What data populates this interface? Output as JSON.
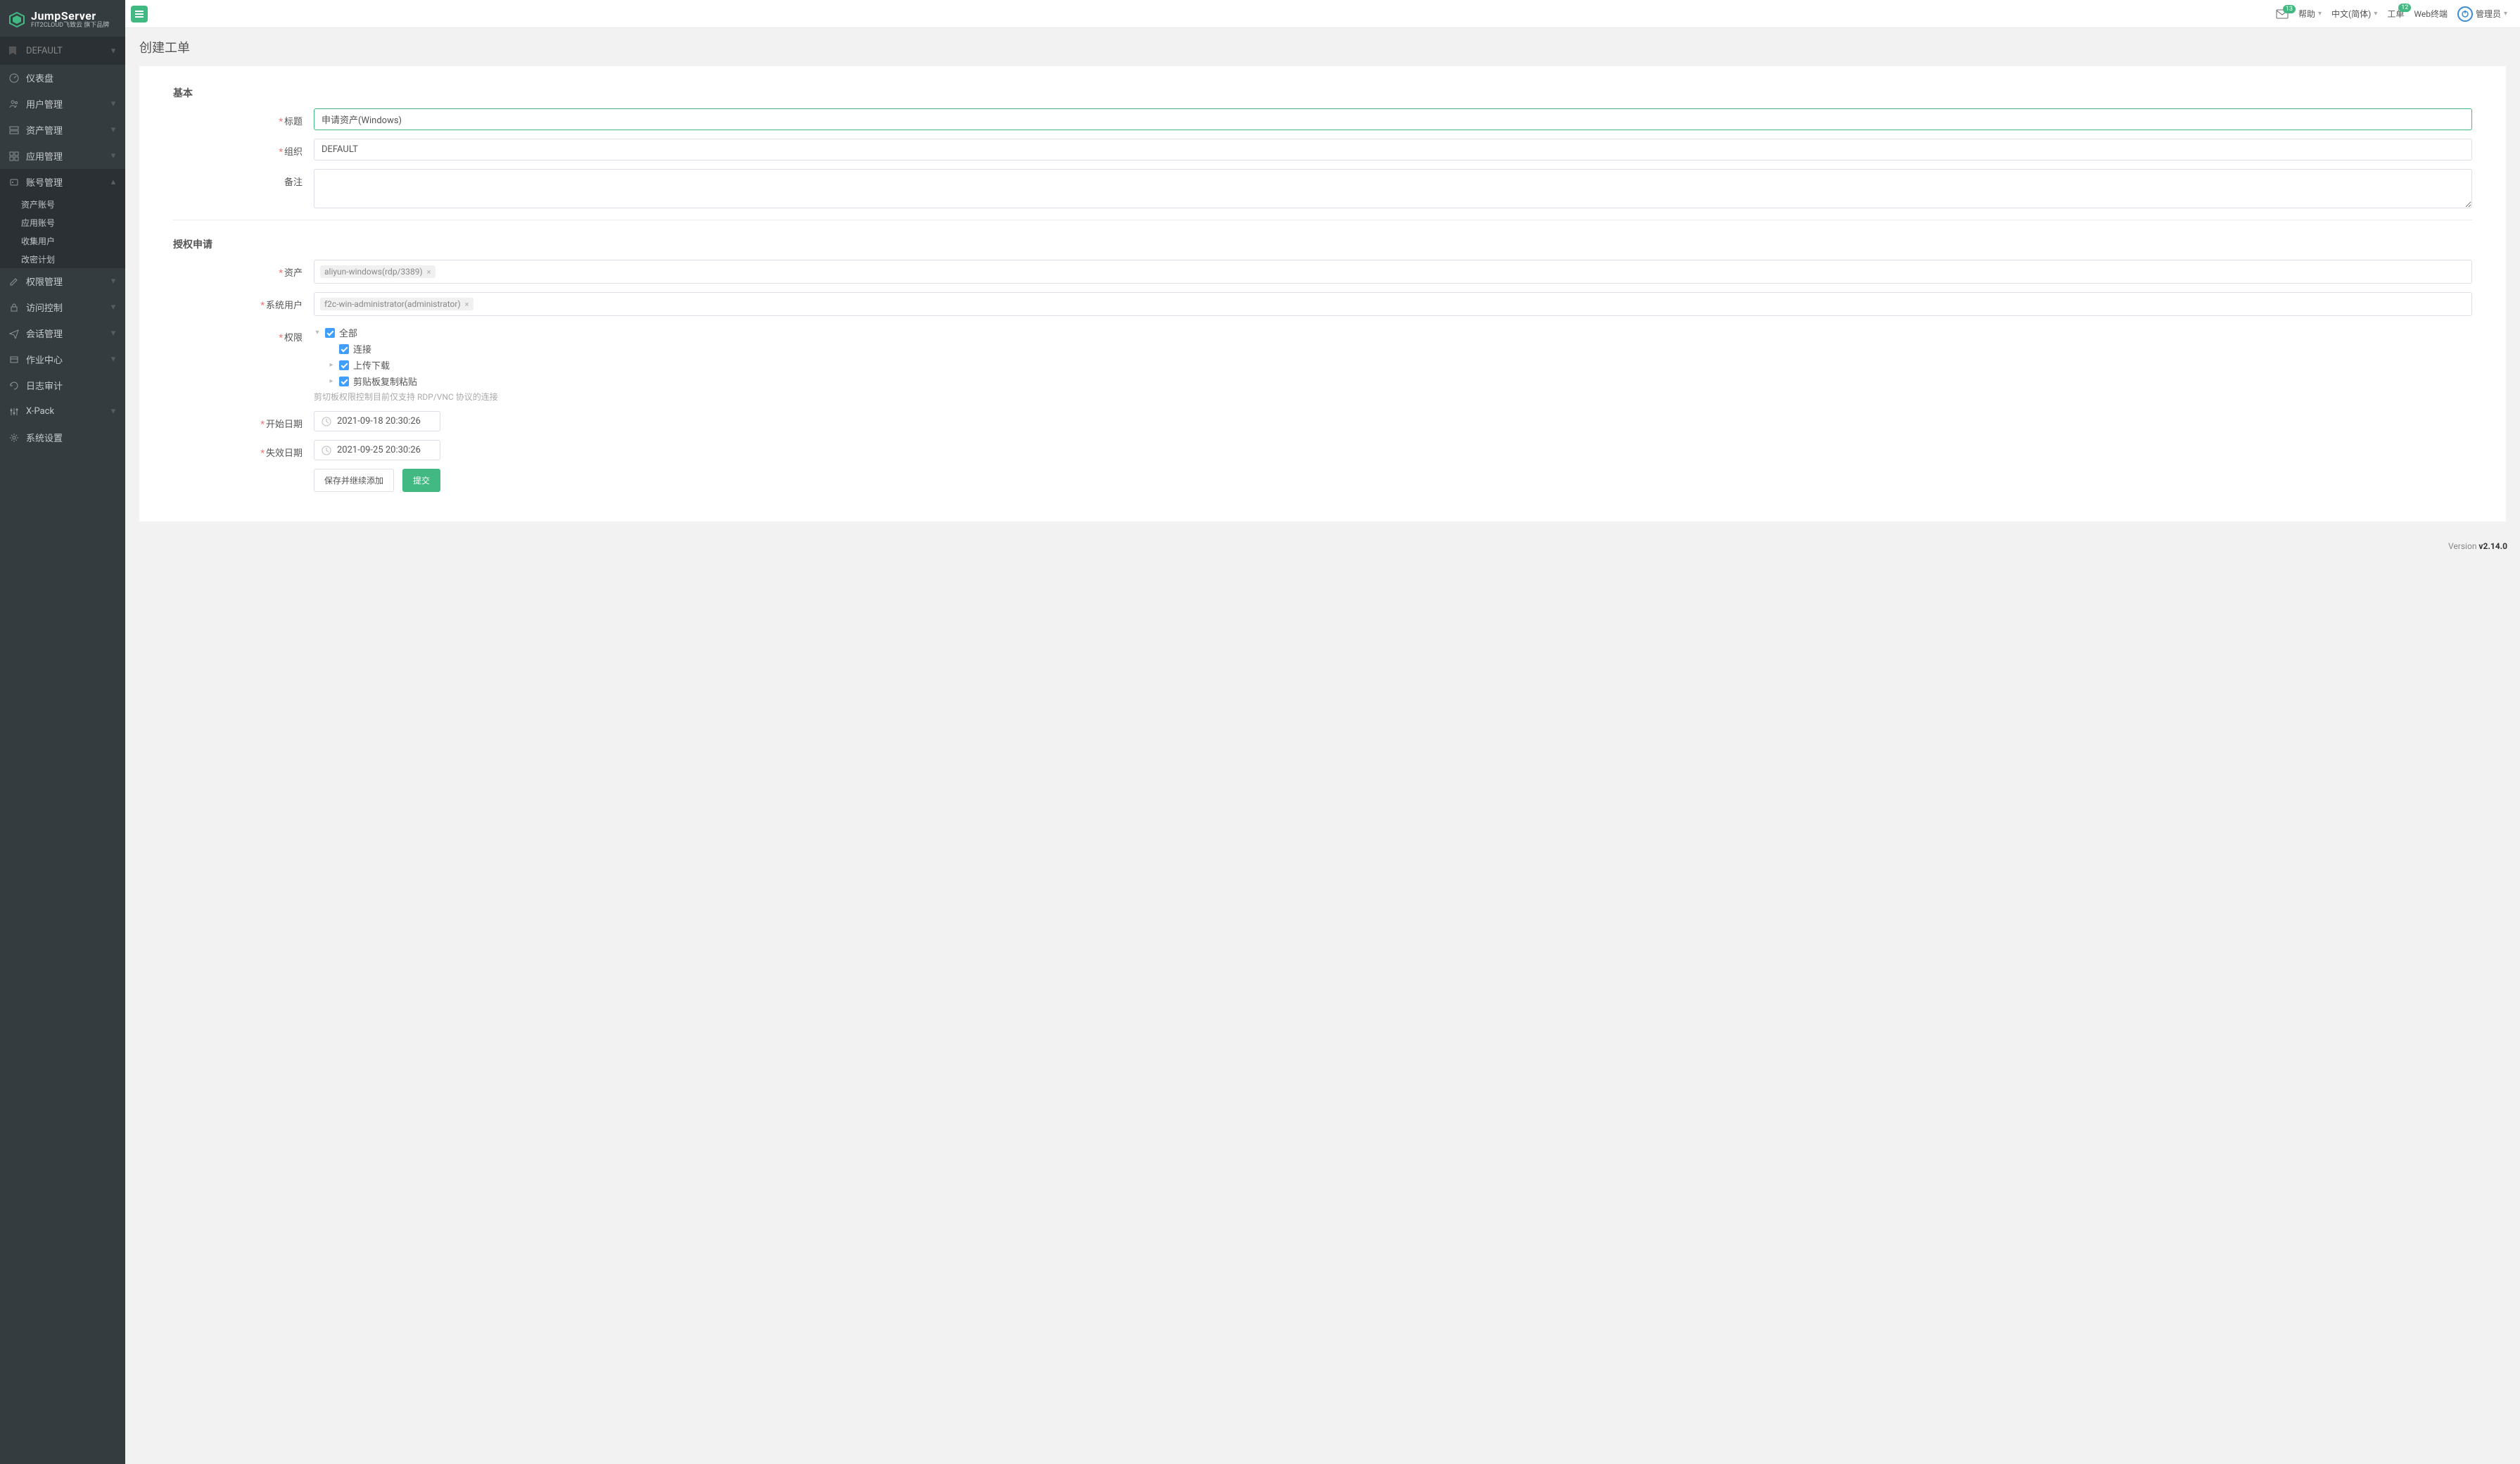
{
  "brand": {
    "main": "JumpServer",
    "sub": "FIT2CLOUD飞致云 旗下品牌"
  },
  "topnav": {
    "help": "帮助",
    "lang": "中文(简体)",
    "tickets": "工单",
    "web_terminal": "Web终端",
    "user": "管理员",
    "mail_badge": "13",
    "ticket_badge": "12"
  },
  "sidebar": {
    "scope_label": "DEFAULT",
    "items": [
      {
        "icon": "dashboard",
        "label": "仪表盘",
        "sub": null
      },
      {
        "icon": "users",
        "label": "用户管理",
        "caret": true
      },
      {
        "icon": "server",
        "label": "资产管理",
        "caret": true
      },
      {
        "icon": "grid",
        "label": "应用管理",
        "caret": true
      },
      {
        "icon": "key",
        "label": "账号管理",
        "caret": true,
        "expanded": true,
        "children": [
          "资产账号",
          "应用账号",
          "收集用户",
          "改密计划"
        ]
      },
      {
        "icon": "edit",
        "label": "权限管理",
        "caret": true
      },
      {
        "icon": "lock",
        "label": "访问控制",
        "caret": true
      },
      {
        "icon": "send",
        "label": "会话管理",
        "caret": true
      },
      {
        "icon": "tasks",
        "label": "作业中心",
        "caret": true
      },
      {
        "icon": "history",
        "label": "日志审计"
      },
      {
        "icon": "sliders",
        "label": "X-Pack",
        "caret": true
      },
      {
        "icon": "cogs",
        "label": "系统设置"
      }
    ]
  },
  "page_title": "创建工单",
  "sections": {
    "basic": "基本",
    "auth": "授权申请"
  },
  "form": {
    "title_label": "标题",
    "title_value": "申请资产(Windows)",
    "org_label": "组织",
    "org_value": "DEFAULT",
    "note_label": "备注",
    "note_value": "",
    "asset_label": "资产",
    "asset_tags": [
      "aliyun-windows(rdp/3389)"
    ],
    "sysuser_label": "系统用户",
    "sysuser_tags": [
      "f2c-win-administrator(administrator)"
    ],
    "perm_label": "权限",
    "perm_tree": {
      "root": "全部",
      "children": [
        "连接",
        "上传下载",
        "剪贴板复制粘贴"
      ]
    },
    "perm_hint": "剪切板权限控制目前仅支持 RDP/VNC 协议的连接",
    "start_label": "开始日期",
    "start_value": "2021-09-18 20:30:26",
    "end_label": "失效日期",
    "end_value": "2021-09-25 20:30:26"
  },
  "buttons": {
    "save_more": "保存并继续添加",
    "submit": "提交"
  },
  "footer": {
    "version_prefix": "Version ",
    "version": "v2.14.0"
  }
}
